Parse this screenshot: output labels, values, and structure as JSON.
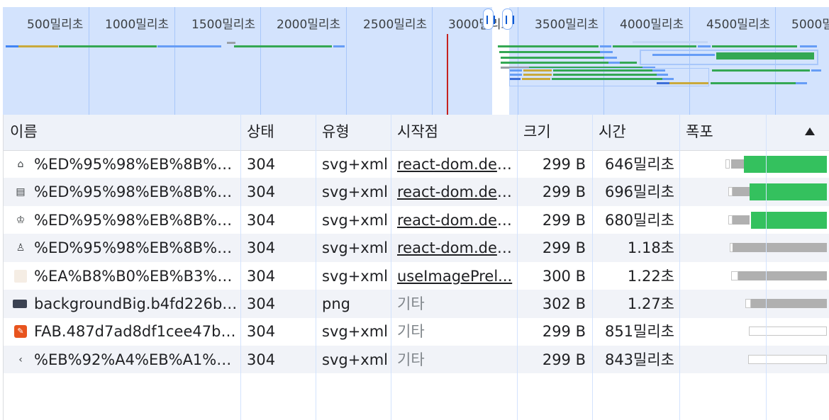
{
  "overview": {
    "tick_labels": [
      "500밀리초",
      "1000밀리초",
      "1500밀리초",
      "2000밀리초",
      "2500밀리초",
      "3000밀리초",
      "3500밀리초",
      "4000밀리초",
      "4500밀리초",
      "5000밀리초"
    ],
    "handle_left_icon": "pause-handle-icon",
    "handle_right_icon": "pause-handle-icon",
    "colors": {
      "background": "#d3e3fd",
      "green": "#34a853",
      "blue": "#669df6",
      "yellow": "#c9a93b",
      "gray": "#9aa0a6",
      "marker_red": "#c5221f"
    }
  },
  "table": {
    "headers": {
      "name": "이름",
      "status": "상태",
      "type": "유형",
      "initiator": "시작점",
      "size": "크기",
      "time": "시간",
      "waterfall": "폭포"
    },
    "sort_indicator": "sort-ascending-icon",
    "rows": [
      {
        "icon": "home-icon",
        "name": "%ED%95%98%EB%8B%A8...",
        "status": "304",
        "type": "svg+xml",
        "initiator": "react-dom.dev...",
        "initiator_is_link": true,
        "size": "299 B",
        "time": "646밀리초"
      },
      {
        "icon": "document-icon",
        "name": "%ED%95%98%EB%8B%A8...",
        "status": "304",
        "type": "svg+xml",
        "initiator": "react-dom.dev...",
        "initiator_is_link": true,
        "size": "299 B",
        "time": "696밀리초"
      },
      {
        "icon": "badge-icon",
        "name": "%ED%95%98%EB%8B%A8...",
        "status": "304",
        "type": "svg+xml",
        "initiator": "react-dom.dev...",
        "initiator_is_link": true,
        "size": "299 B",
        "time": "680밀리초"
      },
      {
        "icon": "person-icon",
        "name": "%ED%95%98%EB%8B%A8...",
        "status": "304",
        "type": "svg+xml",
        "initiator": "react-dom.dev...",
        "initiator_is_link": true,
        "size": "299 B",
        "time": "1.18초"
      },
      {
        "icon": "image-thumbnail-icon",
        "name": "%EA%B8%B0%EB%B3%B8...",
        "status": "304",
        "type": "svg+xml",
        "initiator": "useImagePrel...",
        "initiator_is_link": true,
        "size": "300 B",
        "time": "1.22초"
      },
      {
        "icon": "image-thumbnail-icon",
        "name": "backgroundBig.b4fd226bb...",
        "status": "304",
        "type": "png",
        "initiator": "기타",
        "initiator_is_link": false,
        "size": "302 B",
        "time": "1.27초"
      },
      {
        "icon": "orange-app-icon",
        "name": "FAB.487d7ad8df1cee47b0...",
        "status": "304",
        "type": "svg+xml",
        "initiator": "기타",
        "initiator_is_link": false,
        "size": "299 B",
        "time": "851밀리초"
      },
      {
        "icon": "chevron-left-icon",
        "name": "%EB%92%A4%EB%A1%9C...",
        "status": "304",
        "type": "svg+xml",
        "initiator": "기타",
        "initiator_is_link": false,
        "size": "299 B",
        "time": "843밀리초"
      }
    ],
    "waterfall_colors": {
      "waiting": "#b0b0b0",
      "download": "#34c15e",
      "queue": "#ffffff"
    }
  }
}
